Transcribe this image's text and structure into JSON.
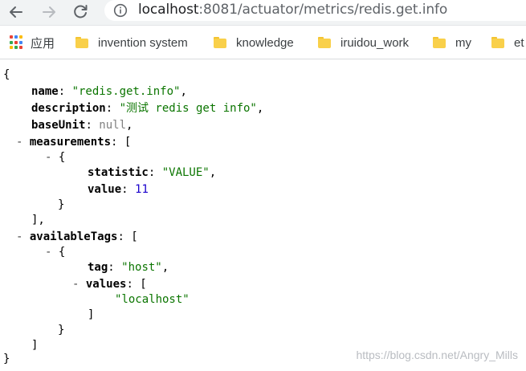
{
  "browser": {
    "url_host": "localhost",
    "url_rest": ":8081/actuator/metrics/redis.get.info",
    "bookmarks": [
      {
        "label": "应用",
        "icon": "apps-grid-icon"
      },
      {
        "label": "invention system",
        "icon": "folder-icon"
      },
      {
        "label": "knowledge",
        "icon": "folder-icon"
      },
      {
        "label": "iruidou_work",
        "icon": "folder-icon"
      },
      {
        "label": "my",
        "icon": "folder-icon"
      },
      {
        "label": "et",
        "icon": "folder-icon"
      }
    ]
  },
  "json": {
    "name_key": "name",
    "name_value": "\"redis.get.info\"",
    "description_key": "description",
    "description_value": "\"测试 redis get info\"",
    "baseUnit_key": "baseUnit",
    "baseUnit_value": "null",
    "measurements_key": "measurements",
    "statistic_key": "statistic",
    "statistic_value": "\"VALUE\"",
    "value_key": "value",
    "value_value": "11",
    "availableTags_key": "availableTags",
    "tag_key": "tag",
    "tag_value": "\"host\"",
    "values_key": "values",
    "values_item": "\"localhost\""
  },
  "watermark": "https://blog.csdn.net/Angry_Mills",
  "colors": {
    "string": "#0b7500",
    "number": "#1a01cc",
    "null": "#808080"
  }
}
